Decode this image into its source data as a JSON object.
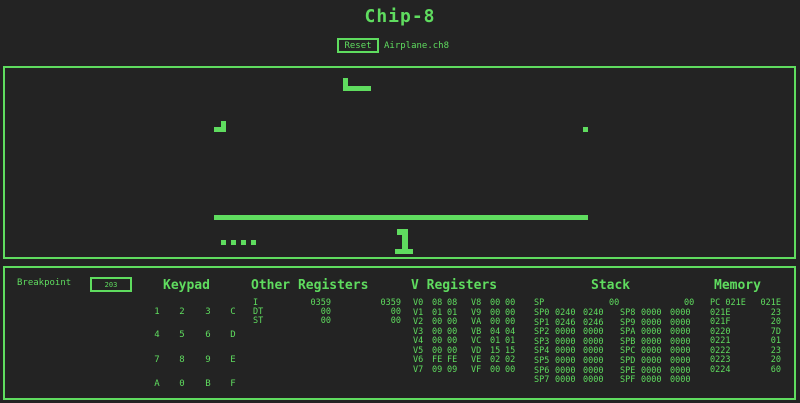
{
  "app": {
    "title": "Chip-8"
  },
  "toolbar": {
    "reset_label": "Reset",
    "rom_name": "Airplane.ch8"
  },
  "display": {
    "score": "1"
  },
  "debugger": {
    "breakpoint_label": "Breakpoint",
    "breakpoint_value": "203",
    "keypad_title": "Keypad",
    "keypad_rows": [
      [
        "1",
        "2",
        "3",
        "C"
      ],
      [
        "4",
        "5",
        "6",
        "D"
      ],
      [
        "7",
        "8",
        "9",
        "E"
      ],
      [
        "A",
        "0",
        "B",
        "F"
      ]
    ],
    "other_registers_title": "Other Registers",
    "other_registers": [
      {
        "name": "I",
        "a": "0359",
        "b": "0359"
      },
      {
        "name": "DT",
        "a": "00",
        "b": "00"
      },
      {
        "name": "ST",
        "a": "00",
        "b": "00"
      }
    ],
    "v_registers_title": "V Registers",
    "v_registers": [
      {
        "n1": "V0",
        "a1": "08",
        "b1": "08",
        "n2": "V8",
        "a2": "00",
        "b2": "00"
      },
      {
        "n1": "V1",
        "a1": "01",
        "b1": "01",
        "n2": "V9",
        "a2": "00",
        "b2": "00"
      },
      {
        "n1": "V2",
        "a1": "00",
        "b1": "00",
        "n2": "VA",
        "a2": "00",
        "b2": "00"
      },
      {
        "n1": "V3",
        "a1": "00",
        "b1": "00",
        "n2": "VB",
        "a2": "04",
        "b2": "04"
      },
      {
        "n1": "V4",
        "a1": "00",
        "b1": "00",
        "n2": "VC",
        "a2": "01",
        "b2": "01"
      },
      {
        "n1": "V5",
        "a1": "00",
        "b1": "00",
        "n2": "VD",
        "a2": "15",
        "b2": "15"
      },
      {
        "n1": "V6",
        "a1": "FE",
        "b1": "FE",
        "n2": "VE",
        "a2": "02",
        "b2": "02"
      },
      {
        "n1": "V7",
        "a1": "09",
        "b1": "09",
        "n2": "VF",
        "a2": "00",
        "b2": "00"
      }
    ],
    "stack_title": "Stack",
    "stack_sp": {
      "name": "SP",
      "a": "00",
      "b": "00"
    },
    "stack": [
      {
        "n1": "SP0",
        "a1": "0240",
        "b1": "0240",
        "n2": "SP8",
        "a2": "0000",
        "b2": "0000"
      },
      {
        "n1": "SP1",
        "a1": "0246",
        "b1": "0246",
        "n2": "SP9",
        "a2": "0000",
        "b2": "0000"
      },
      {
        "n1": "SP2",
        "a1": "0000",
        "b1": "0000",
        "n2": "SPA",
        "a2": "0000",
        "b2": "0000"
      },
      {
        "n1": "SP3",
        "a1": "0000",
        "b1": "0000",
        "n2": "SPB",
        "a2": "0000",
        "b2": "0000"
      },
      {
        "n1": "SP4",
        "a1": "0000",
        "b1": "0000",
        "n2": "SPC",
        "a2": "0000",
        "b2": "0000"
      },
      {
        "n1": "SP5",
        "a1": "0000",
        "b1": "0000",
        "n2": "SPD",
        "a2": "0000",
        "b2": "0000"
      },
      {
        "n1": "SP6",
        "a1": "0000",
        "b1": "0000",
        "n2": "SPE",
        "a2": "0000",
        "b2": "0000"
      },
      {
        "n1": "SP7",
        "a1": "0000",
        "b1": "0000",
        "n2": "SPF",
        "a2": "0000",
        "b2": "0000"
      }
    ],
    "memory_title": "Memory",
    "memory": [
      {
        "addr": "PC 021E",
        "val": "021E"
      },
      {
        "addr": "021E",
        "val": "23"
      },
      {
        "addr": "021F",
        "val": "20"
      },
      {
        "addr": "0220",
        "val": "7D"
      },
      {
        "addr": "0221",
        "val": "01"
      },
      {
        "addr": "0222",
        "val": "23"
      },
      {
        "addr": "0223",
        "val": "20"
      },
      {
        "addr": "0224",
        "val": "60"
      }
    ]
  },
  "colors": {
    "foreground": "#5fdc5f",
    "background": "#232323"
  }
}
